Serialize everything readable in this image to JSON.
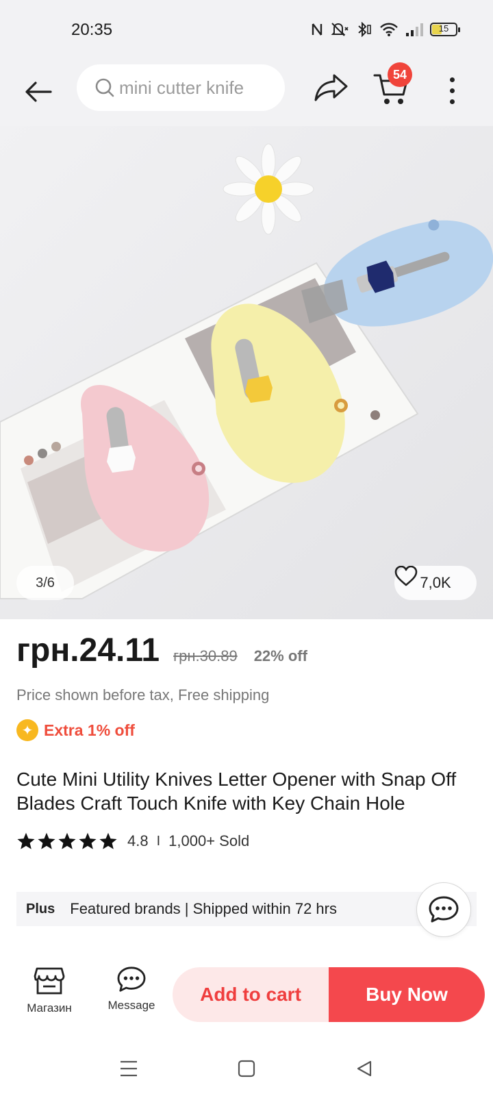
{
  "status_bar": {
    "time": "20:35",
    "battery": "15"
  },
  "top_nav": {
    "search_text": "mini cutter knife",
    "cart_count": "54"
  },
  "product_image": {
    "counter": "3/6",
    "wishlist_count": "7,0K"
  },
  "price": {
    "current": "грн.24.11",
    "original": "грн.30.89",
    "discount": "22% off",
    "tax_note": "Price shown before tax, Free shipping",
    "extra_off": "Extra 1% off"
  },
  "product": {
    "title": "Cute Mini Utility Knives Letter Opener with Snap Off Blades Craft Touch Knife with Key Chain Hole",
    "rating": "4.8",
    "rating_separator": "I",
    "sold": "1,000+ Sold",
    "stars": 5
  },
  "plus_banner": {
    "label": "Plus",
    "text": "Featured brands | Shipped within 72 hrs"
  },
  "actions": {
    "store_label": "Магазин",
    "message_label": "Message",
    "add_to_cart": "Add to cart",
    "buy_now": "Buy Now"
  },
  "colors": {
    "accent_red": "#f4484d",
    "add_cart_bg": "#fde8e8",
    "badge_red": "#f0443a",
    "coin_yellow": "#f8b820"
  },
  "icons": [
    "back-arrow-icon",
    "search-icon",
    "share-icon",
    "cart-icon",
    "more-icon",
    "heart-icon",
    "coin-icon",
    "star-icon",
    "chat-icon",
    "store-icon",
    "message-icon",
    "menu-icon",
    "home-icon",
    "back-icon"
  ]
}
